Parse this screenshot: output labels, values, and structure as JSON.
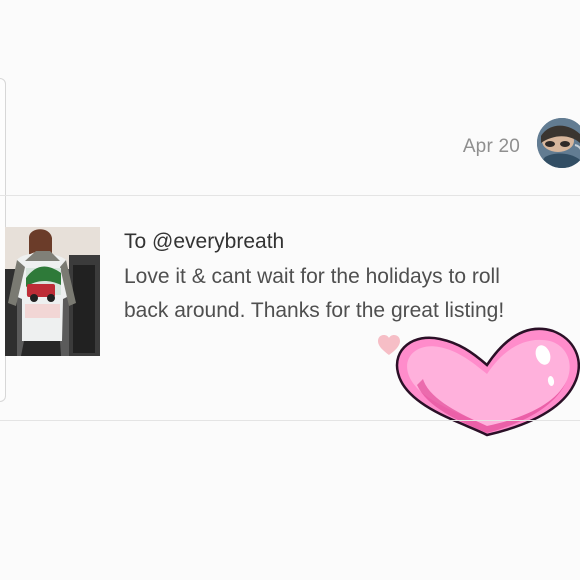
{
  "review": {
    "date": "Apr 20",
    "to": "To @everybreath",
    "message_line1": "Love it & cant wait for the holidays to roll",
    "message_line2": "back around. Thanks for the great listing!"
  },
  "icons": {
    "avatar": "user-avatar",
    "thumbnail": "listing-thumbnail",
    "small_heart": "heart-icon",
    "big_heart": "heart-sticker-icon"
  },
  "colors": {
    "background": "#fbfbfb",
    "date_text": "#8f8f8f",
    "review_text": "#4f4f4f",
    "heart_pink": "#ff8dc8",
    "heart_outline": "#c71f6b",
    "small_heart": "#f4b5bf"
  }
}
